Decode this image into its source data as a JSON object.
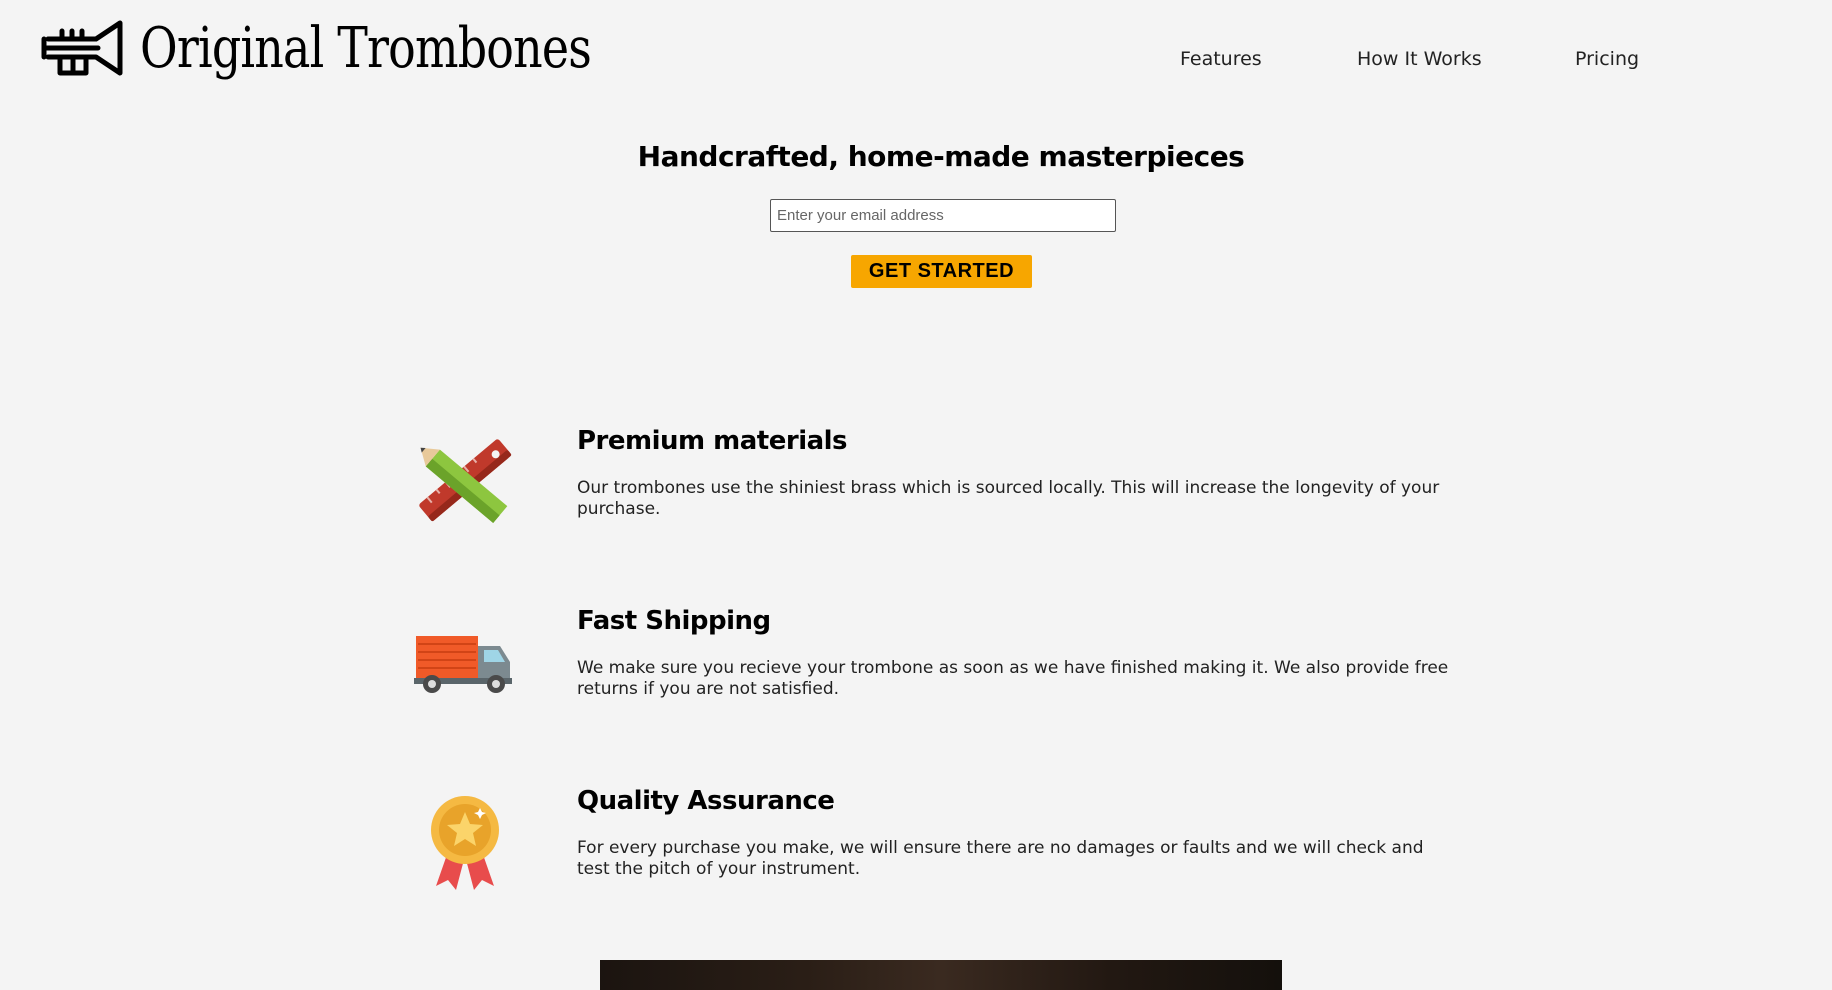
{
  "header": {
    "logo_text": "Original Trombones",
    "logo_icon": "trumpet-icon",
    "nav": [
      {
        "label": "Features"
      },
      {
        "label": "How It Works"
      },
      {
        "label": "Pricing"
      }
    ]
  },
  "hero": {
    "title": "Handcrafted, home-made masterpieces",
    "email_placeholder": "Enter your email address",
    "cta_label": "GET STARTED"
  },
  "features": [
    {
      "icon": "pencil-ruler-icon",
      "title": "Premium materials",
      "text": "Our trombones use the shiniest brass which is sourced locally. This will increase the longevity of your purchase."
    },
    {
      "icon": "truck-icon",
      "title": "Fast Shipping",
      "text": "We make sure you recieve your trombone as soon as we have finished making it. We also provide free returns if you are not satisfied."
    },
    {
      "icon": "medal-icon",
      "title": "Quality Assurance",
      "text": "For every purchase you make, we will ensure there are no damages or faults and we will check and test the pitch of your instrument."
    }
  ],
  "colors": {
    "background": "#f4f4f4",
    "cta": "#f7a600",
    "ruler": "#c0392b",
    "pencil": "#8dc63f",
    "truck": "#f05a28",
    "medal": "#f5b942",
    "ribbon": "#e84c4c"
  }
}
